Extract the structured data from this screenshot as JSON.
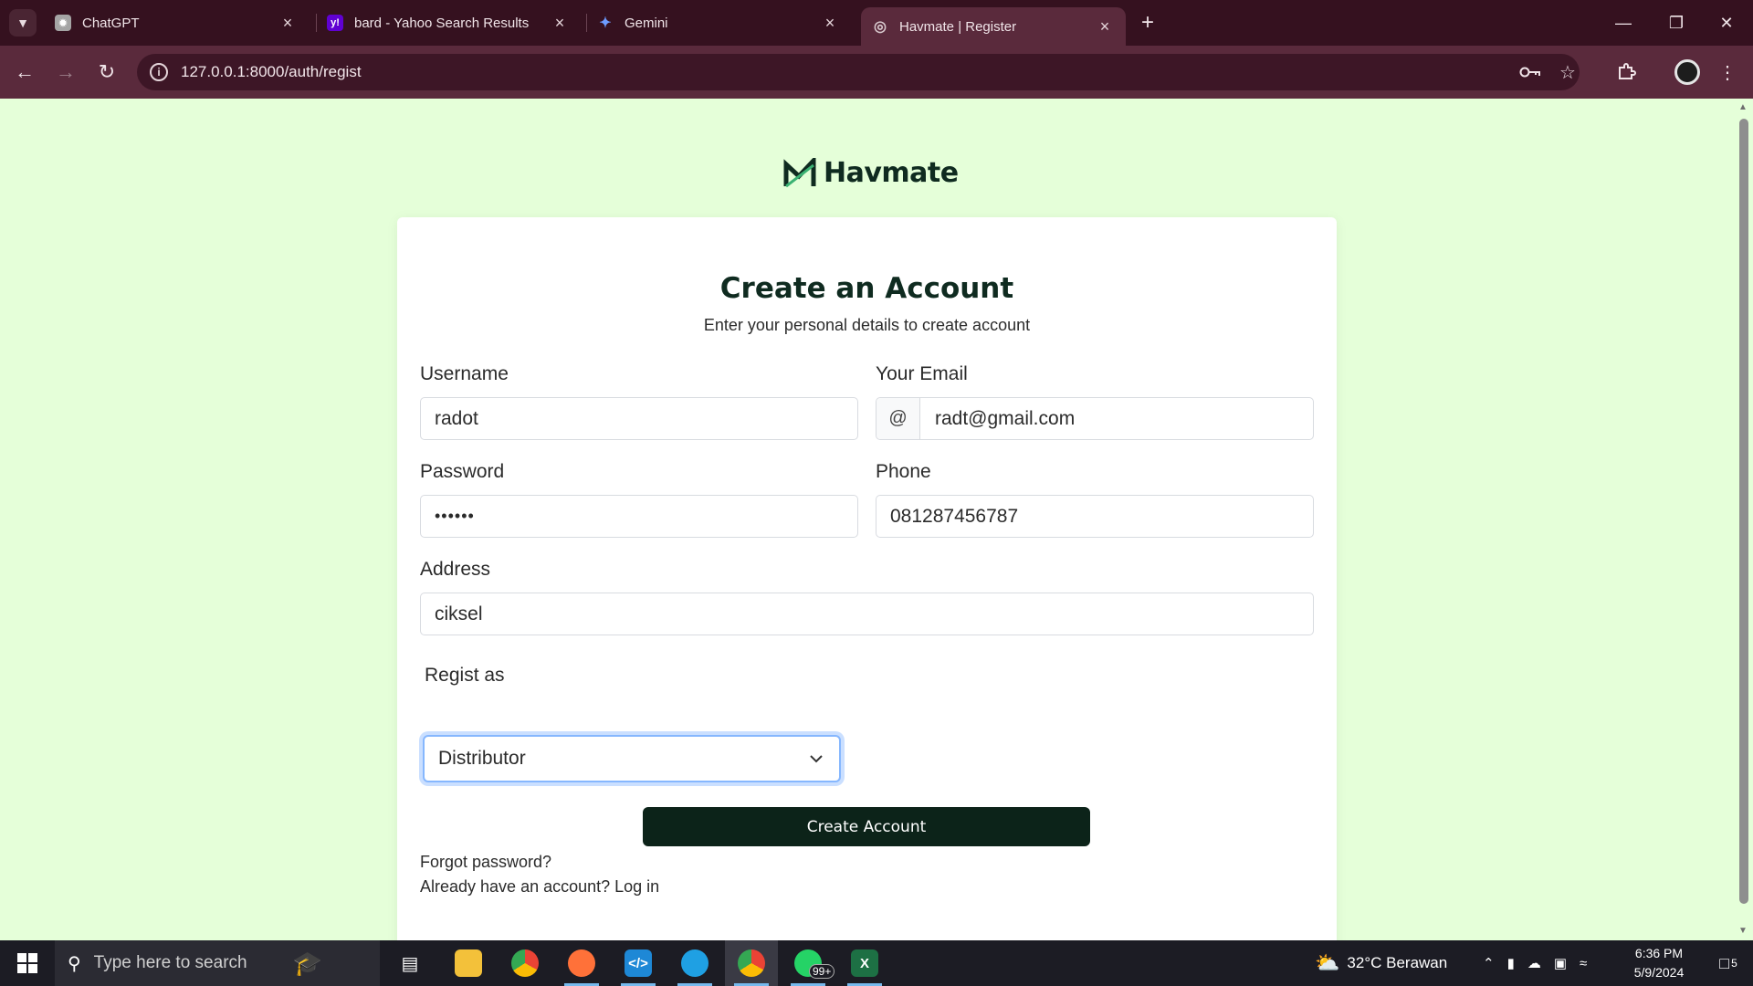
{
  "browser": {
    "tabs": [
      {
        "title": "ChatGPT",
        "icon": "chatgpt-icon"
      },
      {
        "title": "bard - Yahoo Search Results",
        "icon": "yahoo-icon"
      },
      {
        "title": "Gemini",
        "icon": "gemini-icon"
      },
      {
        "title": "Havmate | Register",
        "icon": "globe-icon",
        "active": true
      }
    ],
    "url": "127.0.0.1:8000/auth/regist"
  },
  "page": {
    "brand": "Havmate",
    "title": "Create an Account",
    "subtitle": "Enter your personal details to create account",
    "username": {
      "label": "Username",
      "value": "radot"
    },
    "email": {
      "label": "Your Email",
      "prefix": "@",
      "value": "radt@gmail.com"
    },
    "password": {
      "label": "Password",
      "value": "••••••"
    },
    "phone": {
      "label": "Phone",
      "value": "081287456787"
    },
    "address": {
      "label": "Address",
      "value": "ciksel"
    },
    "role": {
      "label": "Regist as",
      "value": "Distributor"
    },
    "submit": "Create Account",
    "forgot": "Forgot password?",
    "login": "Already have an account? Log in",
    "accent": "#0c2319",
    "background": "#e5ffd9"
  },
  "taskbar": {
    "search_placeholder": "Type here to search",
    "weather": "32°C  Berawan",
    "time": "6:36 PM",
    "date": "5/9/2024",
    "whatsapp_badge": "99+",
    "notifications": "5"
  }
}
